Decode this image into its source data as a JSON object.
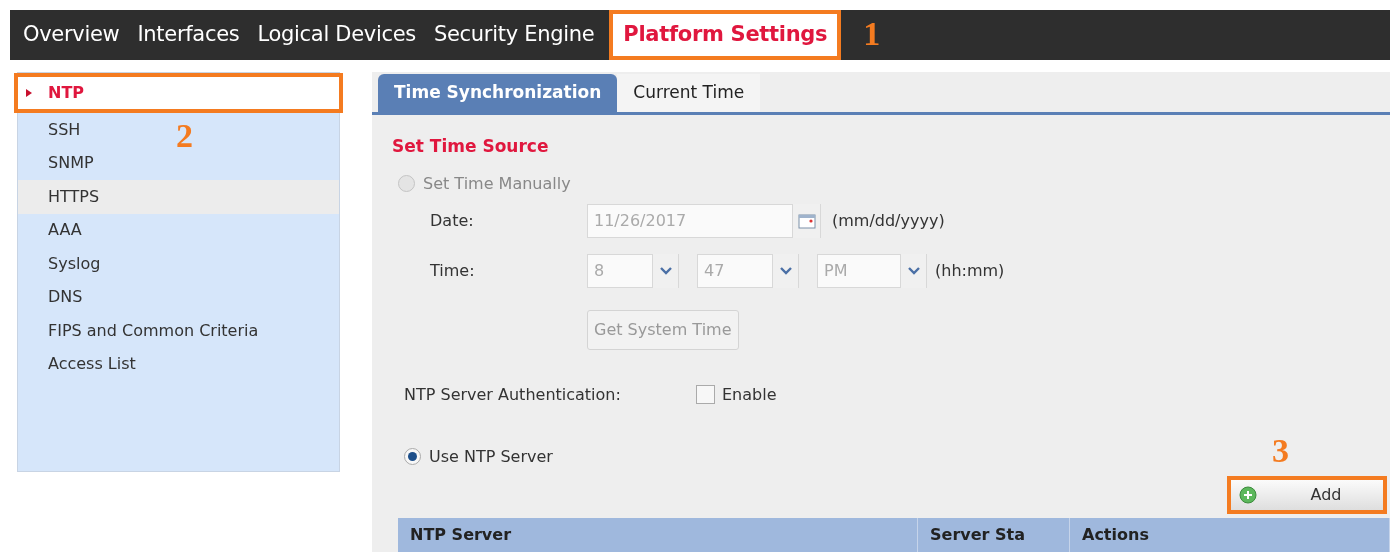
{
  "nav": {
    "tabs": [
      {
        "label": "Overview",
        "selected": false
      },
      {
        "label": "Interfaces",
        "selected": false
      },
      {
        "label": "Logical Devices",
        "selected": false
      },
      {
        "label": "Security Engine",
        "selected": false
      },
      {
        "label": "Platform Settings",
        "selected": true,
        "callout": "1"
      }
    ]
  },
  "sidebar": {
    "items": [
      {
        "label": "NTP",
        "selected": true,
        "hovered": false,
        "callout": "2"
      },
      {
        "label": "SSH",
        "selected": false,
        "hovered": false
      },
      {
        "label": "SNMP",
        "selected": false,
        "hovered": false
      },
      {
        "label": "HTTPS",
        "selected": false,
        "hovered": true
      },
      {
        "label": "AAA",
        "selected": false,
        "hovered": false
      },
      {
        "label": "Syslog",
        "selected": false,
        "hovered": false
      },
      {
        "label": "DNS",
        "selected": false,
        "hovered": false
      },
      {
        "label": "FIPS and Common Criteria",
        "selected": false,
        "hovered": false
      },
      {
        "label": "Access List",
        "selected": false,
        "hovered": false
      }
    ]
  },
  "tabs": [
    {
      "label": "Time Synchronization",
      "selected": true
    },
    {
      "label": "Current Time",
      "selected": false
    }
  ],
  "section_title": "Set Time Source",
  "manual": {
    "label": "Set Time Manually",
    "checked": false,
    "disabled": true
  },
  "date": {
    "label": "Date:",
    "value": "11/26/2017",
    "hint": "(mm/dd/yyyy)"
  },
  "time": {
    "label": "Time:",
    "selects": [
      "8",
      "47",
      "PM"
    ],
    "hint": "(hh:mm)"
  },
  "get_time_button": "Get System Time",
  "auth": {
    "label": "NTP Server Authentication:",
    "option": "Enable",
    "checked": false
  },
  "use_ntp": {
    "label": "Use NTP Server",
    "checked": true
  },
  "add_button": {
    "label": "Add",
    "callout": "3"
  },
  "table": {
    "columns": [
      "NTP Server",
      "Server Sta",
      "Actions"
    ]
  }
}
